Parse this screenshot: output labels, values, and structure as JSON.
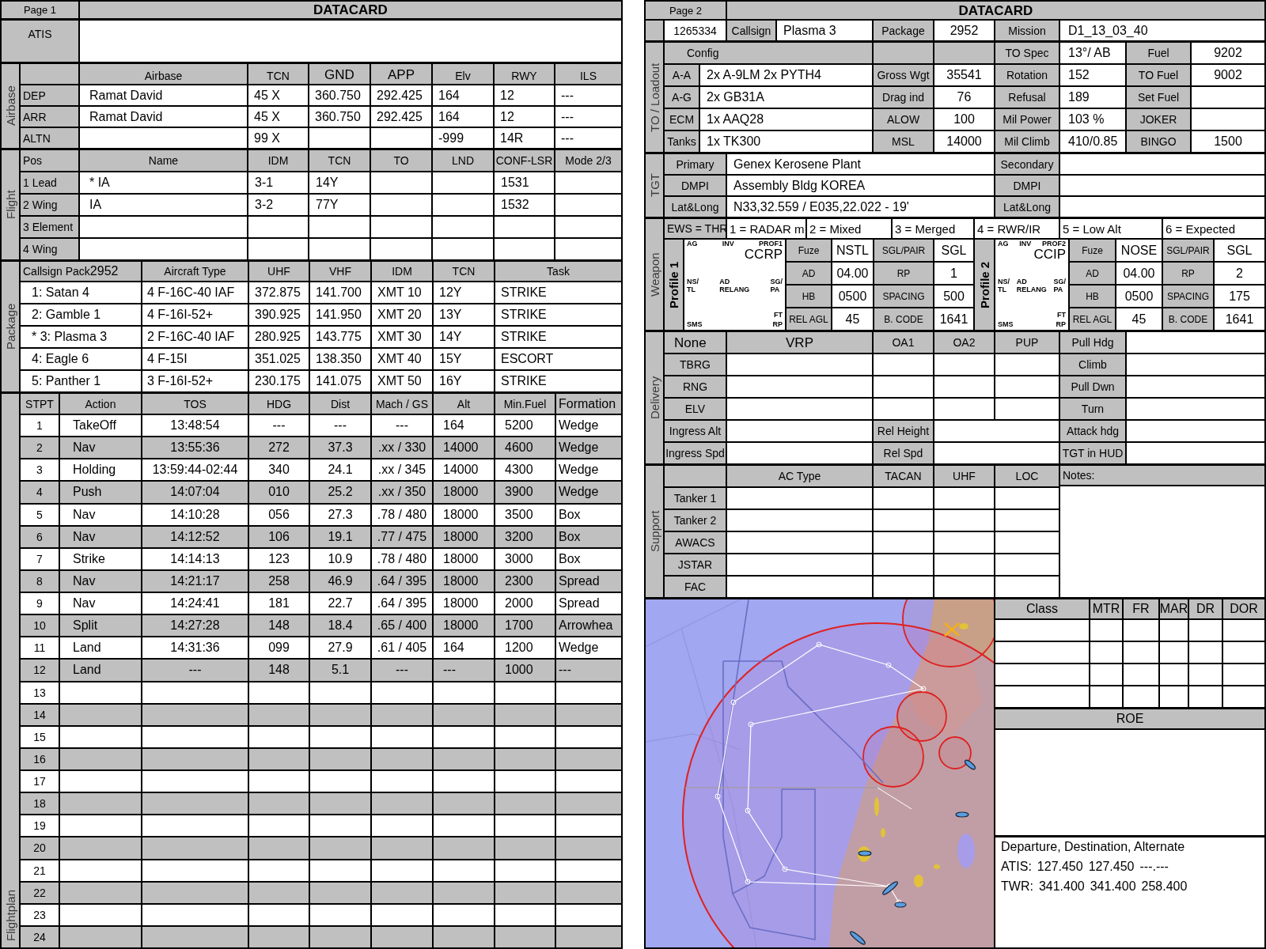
{
  "page1": {
    "page_label": "Page 1",
    "title": "DATACARD",
    "atis_label": "ATIS",
    "airbase": {
      "section": "Airbase",
      "columns": [
        {
          "label": "Airbase",
          "large": false
        },
        {
          "label": "TCN",
          "large": false
        },
        {
          "label": "GND",
          "large": true
        },
        {
          "label": "APP",
          "large": true
        },
        {
          "label": "Elv",
          "large": false
        },
        {
          "label": "RWY",
          "large": false
        },
        {
          "label": "ILS",
          "large": false
        }
      ],
      "rows": [
        {
          "label": "DEP",
          "cells": [
            "Ramat David",
            "45 X",
            "360.750",
            "292.425",
            "164",
            "12",
            "---"
          ]
        },
        {
          "label": "ARR",
          "cells": [
            "Ramat David",
            "45 X",
            "360.750",
            "292.425",
            "164",
            "12",
            "---"
          ]
        },
        {
          "label": "ALTN",
          "cells": [
            null,
            "99 X",
            null,
            null,
            "-999",
            "14R",
            "---"
          ]
        }
      ]
    },
    "flight": {
      "section": "Flight",
      "columns": [
        "Pos",
        "Name",
        "IDM",
        "TCN",
        "TO",
        "LND",
        "CONF-LSR",
        "Mode 2/3"
      ],
      "rows": [
        {
          "label": "1 Lead",
          "cells": [
            "* IA",
            "3-1",
            "14Y",
            null,
            null,
            "1531",
            null
          ]
        },
        {
          "label": "2 Wing",
          "cells": [
            "IA",
            "3-2",
            "77Y",
            null,
            null,
            "1532",
            null
          ]
        },
        {
          "label": "3 Element"
        },
        {
          "label": "4 Wing"
        }
      ]
    },
    "package": {
      "section": "Package",
      "callsign_header": "Callsign Pack",
      "package_number": "2952",
      "columns": [
        "Aircraft Type",
        "UHF",
        "VHF",
        "IDM",
        "TCN",
        "Task"
      ],
      "rows": [
        {
          "callsign": "1: Satan 4",
          "cells": [
            "4 F-16C-40 IAF",
            "372.875",
            "141.700",
            "XMT 10",
            "12Y",
            "STRIKE"
          ]
        },
        {
          "callsign": "2: Gamble 1",
          "cells": [
            "4 F-16I-52+",
            "390.925",
            "141.950",
            "XMT 20",
            "13Y",
            "STRIKE"
          ]
        },
        {
          "callsign": "* 3: Plasma 3",
          "cells": [
            "2 F-16C-40 IAF",
            "280.925",
            "143.775",
            "XMT 30",
            "14Y",
            "STRIKE"
          ]
        },
        {
          "callsign": "4: Eagle 6",
          "cells": [
            "4 F-15I",
            "351.025",
            "138.350",
            "XMT 40",
            "15Y",
            "ESCORT"
          ]
        },
        {
          "callsign": "5: Panther 1",
          "cells": [
            "3 F-16I-52+",
            "230.175",
            "141.075",
            "XMT 50",
            "16Y",
            "STRIKE"
          ]
        }
      ]
    },
    "flightplan": {
      "section": "Flightplan",
      "columns": [
        "STPT",
        "Action",
        "TOS",
        "HDG",
        "Dist",
        "Mach / GS",
        "Alt",
        "Min.Fuel",
        "Formation"
      ],
      "rows": [
        {
          "stpt": "1",
          "cells": [
            "TakeOff",
            "13:48:54",
            "---",
            "---",
            "---",
            "164",
            "5200",
            "Wedge"
          ]
        },
        {
          "stpt": "2",
          "cells": [
            "Nav",
            "13:55:36",
            "272",
            "37.3",
            ".xx / 330",
            "14000",
            "4600",
            "Wedge"
          ]
        },
        {
          "stpt": "3",
          "cells": [
            "Holding",
            "13:59:44-02:44",
            "340",
            "24.1",
            ".xx / 345",
            "14000",
            "4300",
            "Wedge"
          ]
        },
        {
          "stpt": "4",
          "cells": [
            "Push",
            "14:07:04",
            "010",
            "25.2",
            ".xx / 350",
            "18000",
            "3900",
            "Wedge"
          ]
        },
        {
          "stpt": "5",
          "cells": [
            "Nav",
            "14:10:28",
            "056",
            "27.3",
            ".78 / 480",
            "18000",
            "3500",
            "Box"
          ]
        },
        {
          "stpt": "6",
          "cells": [
            "Nav",
            "14:12:52",
            "106",
            "19.1",
            ".77 / 475",
            "18000",
            "3200",
            "Box"
          ]
        },
        {
          "stpt": "7",
          "cells": [
            "Strike",
            "14:14:13",
            "123",
            "10.9",
            ".78 / 480",
            "18000",
            "3000",
            "Box"
          ]
        },
        {
          "stpt": "8",
          "cells": [
            "Nav",
            "14:21:17",
            "258",
            "46.9",
            ".64 / 395",
            "18000",
            "2300",
            "Spread"
          ]
        },
        {
          "stpt": "9",
          "cells": [
            "Nav",
            "14:24:41",
            "181",
            "22.7",
            ".64 / 395",
            "18000",
            "2000",
            "Spread"
          ]
        },
        {
          "stpt": "10",
          "cells": [
            "Split",
            "14:27:28",
            "148",
            "18.4",
            ".65 / 400",
            "18000",
            "1700",
            "Arrowhea"
          ]
        },
        {
          "stpt": "11",
          "cells": [
            "Land",
            "14:31:36",
            "099",
            "27.9",
            ".61 / 405",
            "164",
            "1200",
            "Wedge"
          ]
        },
        {
          "stpt": "12",
          "cells": [
            "Land",
            "---",
            "148",
            "5.1",
            "---",
            "---",
            "1000",
            "---"
          ]
        },
        {
          "stpt": "13"
        },
        {
          "stpt": "14"
        },
        {
          "stpt": "15"
        },
        {
          "stpt": "16"
        },
        {
          "stpt": "17"
        },
        {
          "stpt": "18"
        },
        {
          "stpt": "19"
        },
        {
          "stpt": "20"
        },
        {
          "stpt": "21"
        },
        {
          "stpt": "22"
        },
        {
          "stpt": "23"
        },
        {
          "stpt": "24"
        }
      ]
    }
  },
  "page2": {
    "page_label": "Page 2",
    "title": "DATACARD",
    "mission_row": {
      "id": "1265334",
      "callsign_label": "Callsign",
      "callsign": "Plasma 3",
      "package_label": "Package",
      "package": "2952",
      "mission_label": "Mission",
      "mission": "D1_13_03_40"
    },
    "loadout": {
      "section": "TO / Loadout",
      "config_label": "Config",
      "config_cells": [
        {
          "label": "TO Spec",
          "value": "13°/ AB"
        },
        {
          "label": "Fuel",
          "value": "9202"
        }
      ],
      "rows": [
        {
          "cells": [
            {
              "label": "A-A",
              "value": "2x A-9LM 2x PYTH4"
            },
            {
              "label": "Gross Wgt",
              "value": "35541"
            },
            {
              "label": "Rotation",
              "value": "152"
            },
            {
              "label": "TO Fuel",
              "value": "9002"
            }
          ]
        },
        {
          "cells": [
            {
              "label": "A-G",
              "value": "2x GB31A"
            },
            {
              "label": "Drag ind",
              "value": "76"
            },
            {
              "label": "Refusal",
              "value": "189"
            },
            {
              "label": "Set Fuel"
            }
          ]
        },
        {
          "cells": [
            {
              "label": "ECM",
              "value": "1x AAQ28"
            },
            {
              "label": "ALOW",
              "value": "100"
            },
            {
              "label": "Mil Power",
              "value": "103 %"
            },
            {
              "label": "JOKER"
            }
          ]
        },
        {
          "cells": [
            {
              "label": "Tanks",
              "value": "1x TK300"
            },
            {
              "label": "MSL",
              "value": "14000"
            },
            {
              "label": "Mil Climb",
              "value": "410/0.85"
            },
            {
              "label": "BINGO",
              "value": "1500"
            }
          ]
        }
      ]
    },
    "target": {
      "section": "TGT",
      "rows": [
        {
          "cells": [
            {
              "label": "Primary",
              "value": "Genex Kerosene Plant"
            },
            {
              "label": "Secondary"
            }
          ]
        },
        {
          "cells": [
            {
              "label": "DMPI",
              "value": "Assembly Bldg KOREA"
            },
            {
              "label": "DMPI"
            }
          ]
        },
        {
          "cells": [
            {
              "label": "Lat&Long",
              "value": "N33,32.559 / E035,22.022 - 19'"
            },
            {
              "label": "Lat&Long"
            }
          ]
        }
      ]
    },
    "weapon": {
      "section": "Weapon",
      "ews_label": "EWS = THR",
      "ews_cells": [
        "1 = RADAR m",
        "2 = Mixed",
        "3 = Merged",
        "4 = RWR/IR",
        "5 = Low Alt",
        "6 = Expected"
      ],
      "profiles": [
        {
          "label": "Profile 1",
          "sms": {
            "top": [
              "AG",
              "INV",
              "PROF1"
            ],
            "mode": "CCRP",
            "middle": [
              "NS/\nTL",
              "AD\nRELANG",
              "SG/\nPA"
            ],
            "ft": "FT",
            "bottom": [
              "SMS",
              "RP"
            ]
          },
          "rows": [
            {
              "cells": [
                {
                  "label": "Fuze",
                  "value": "NSTL"
                },
                {
                  "label": "SGL/PAIR",
                  "value": "SGL"
                }
              ]
            },
            {
              "cells": [
                {
                  "label": "AD",
                  "value": "04.00"
                },
                {
                  "label": "RP",
                  "value": "1"
                }
              ]
            },
            {
              "cells": [
                {
                  "label": "HB",
                  "value": "0500"
                },
                {
                  "label": "SPACING",
                  "value": "500"
                }
              ]
            },
            {
              "cells": [
                {
                  "label": "REL AGL",
                  "value": "45"
                },
                {
                  "label": "B. CODE",
                  "value": "1641"
                }
              ]
            }
          ]
        },
        {
          "label": "Profile 2",
          "sms": {
            "top": [
              "AG",
              "INV",
              "PROF2"
            ],
            "mode": "CCIP",
            "middle": [
              "NS/\nTL",
              "AD\nRELANG",
              "SG/\nPA"
            ],
            "ft": "FT",
            "bottom": [
              "SMS",
              "RP"
            ]
          },
          "rows": [
            {
              "cells": [
                {
                  "label": "Fuze",
                  "value": "NOSE"
                },
                {
                  "label": "SGL/PAIR",
                  "value": "SGL"
                }
              ]
            },
            {
              "cells": [
                {
                  "label": "AD",
                  "value": "04.00"
                },
                {
                  "label": "RP",
                  "value": "2"
                }
              ]
            },
            {
              "cells": [
                {
                  "label": "HB",
                  "value": "0500"
                },
                {
                  "label": "SPACING",
                  "value": "175"
                }
              ]
            },
            {
              "cells": [
                {
                  "label": "REL AGL",
                  "value": "45"
                },
                {
                  "label": "B. CODE",
                  "value": "1641"
                }
              ]
            }
          ]
        }
      ]
    },
    "delivery": {
      "section": "Delivery",
      "header": {
        "label": "None",
        "columns": [
          "VRP",
          "OA1",
          "OA2",
          "PUP"
        ],
        "side_label": "Pull Hdg"
      },
      "point_rows": [
        {
          "label": "TBRG",
          "side_label": "Climb"
        },
        {
          "label": "RNG",
          "side_label": "Pull Dwn"
        },
        {
          "label": "ELV",
          "side_label": "Turn"
        }
      ],
      "ingress_rows": [
        {
          "label": "Ingress Alt",
          "mid_label": "Rel Height",
          "side_label": "Attack hdg"
        },
        {
          "label": "Ingress Spd",
          "mid_label": "Rel Spd",
          "side_label": "TGT in HUD"
        }
      ]
    },
    "support": {
      "section": "Support",
      "columns": [
        "AC Type",
        "TACAN",
        "UHF",
        "LOC"
      ],
      "notes_label": "Notes:",
      "rows": [
        {
          "label": "Tanker 1"
        },
        {
          "label": "Tanker 2"
        },
        {
          "label": "AWACS"
        },
        {
          "label": "JSTAR"
        },
        {
          "label": "FAC"
        }
      ]
    },
    "classification": {
      "columns": [
        "Class",
        "MTR",
        "FR",
        "MAR",
        "DR",
        "DOR"
      ]
    },
    "roe_label": "ROE",
    "frequencies": {
      "title": "Departure, Destination, Alternate",
      "lines": [
        {
          "label": "ATIS:",
          "values": [
            "127.450",
            "127.450",
            "---.---"
          ]
        },
        {
          "label": "TWR:",
          "values": [
            "341.400",
            "341.400",
            "258.400"
          ]
        }
      ]
    }
  }
}
